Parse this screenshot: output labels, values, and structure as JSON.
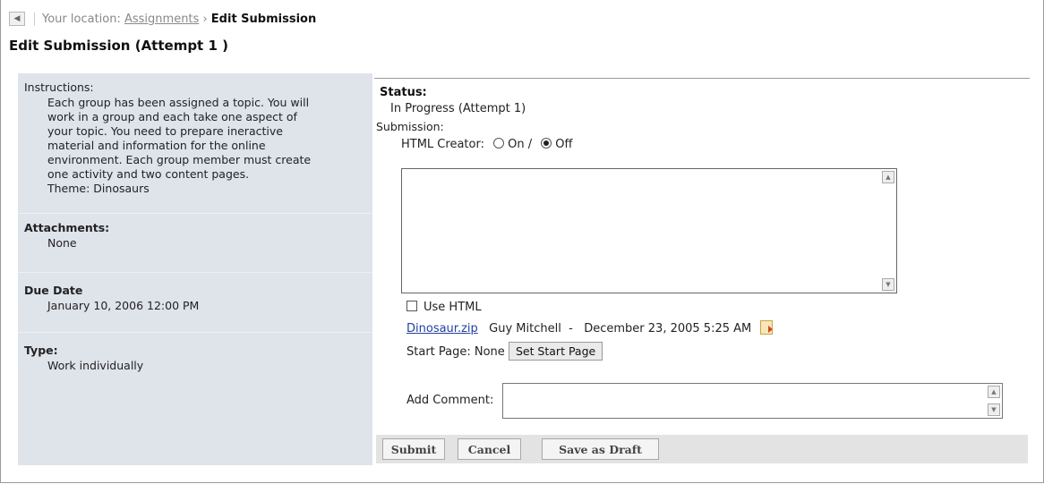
{
  "breadcrumb": {
    "back_icon": "chevron-left-icon",
    "prefix": "Your location: ",
    "parent": "Assignments",
    "separator": "›",
    "current": "Edit Submission"
  },
  "page_title": "Edit Submission (Attempt 1 )",
  "left_panel": {
    "instructions_label": "Instructions:",
    "instructions_lines": [
      "Each group has been assigned a topic. You will",
      "work in a group and each take one aspect of",
      "your topic. You need to prepare ineractive",
      "material and information for the online",
      "environment. Each group member must create",
      "one activity and two content pages.",
      "Theme: Dinosaurs"
    ],
    "attachments_label": "Attachments:",
    "attachments_value": "None",
    "due_date_label": "Due Date",
    "due_date_value": "January 10, 2006 12:00 PM",
    "type_label": "Type:",
    "type_value": "Work individually"
  },
  "right_panel": {
    "status_label": "Status:",
    "status_value": "In Progress (Attempt 1)",
    "submission_label": "Submission:",
    "html_creator_label": "HTML Creator:",
    "html_creator_on": "On /",
    "html_creator_off": "Off",
    "html_creator_selected": "Off",
    "submission_text": "",
    "use_html_label": "Use HTML",
    "use_html_checked": false,
    "file": {
      "name": "Dinosaur.zip",
      "author": "Guy Mitchell",
      "separator": "-",
      "date": "December 23, 2005 5:25 AM",
      "icon": "file-edit-icon"
    },
    "start_page_label": "Start Page: None",
    "set_start_page_button": "Set Start Page",
    "add_comment_label": "Add Comment:",
    "comment_text": ""
  },
  "actions": {
    "submit": "Submit",
    "cancel": "Cancel",
    "save_draft": "Save as Draft"
  }
}
